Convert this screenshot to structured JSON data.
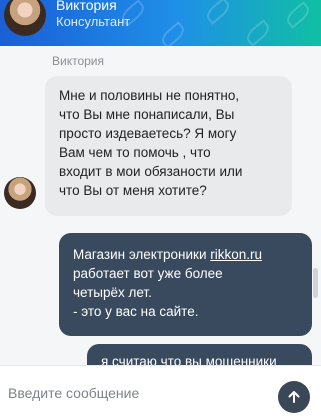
{
  "header": {
    "name": "Виктория",
    "role": "Консультант",
    "gradient_colors": [
      "#1a5fd6",
      "#10bfa4"
    ]
  },
  "chat": {
    "incoming": {
      "sender": "Виктория",
      "lines": [
        "Мне и половины не понятно,",
        "что Вы мне понаписали, Вы",
        "просто издеваетесь? Я могу",
        "Вам чем то помочь , что",
        "входит в мои обязаности или",
        "что Вы от меня хотите?"
      ]
    },
    "outgoing": [
      {
        "prefix": "Магазин электроники ",
        "link": "rikkon.ru",
        "lines": [
          "работает вот уже более",
          "четырёх лет.",
          "- это у вас на сайте."
        ]
      },
      {
        "text": "я считаю что вы мошенники"
      }
    ]
  },
  "composer": {
    "placeholder": "Введите сообщение",
    "value": "",
    "send_icon": "arrow-up-icon"
  },
  "colors": {
    "outgoing_bubble": "#3a4a5e",
    "incoming_bubble": "#e9eaec",
    "send_button": "#394757"
  }
}
